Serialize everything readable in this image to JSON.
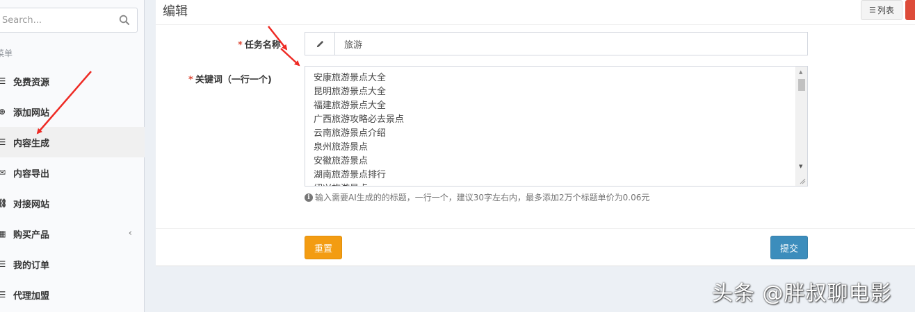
{
  "sidebar": {
    "search_placeholder": "Search...",
    "menu_header": "菜单",
    "items": [
      {
        "label": "免费资源",
        "icon": "list-icon"
      },
      {
        "label": "添加网站",
        "icon": "plus-circle-icon"
      },
      {
        "label": "内容生成",
        "icon": "list-icon"
      },
      {
        "label": "内容导出",
        "icon": "envelope-icon"
      },
      {
        "label": "对接网站",
        "icon": "share-nodes-icon"
      },
      {
        "label": "购买产品",
        "icon": "calendar-icon"
      },
      {
        "label": "我的订单",
        "icon": "list-icon"
      },
      {
        "label": "代理加盟",
        "icon": "list-icon"
      }
    ],
    "active_index": 2
  },
  "header": {
    "title": "编辑",
    "list_button": "列表"
  },
  "form": {
    "task_name_label": "任务名称",
    "task_name_value": "旅游",
    "keywords_label": "关键词（一行一个)",
    "keywords": [
      "安康旅游景点大全",
      "昆明旅游景点大全",
      "福建旅游景点大全",
      "广西旅游攻略必去景点",
      "云南旅游景点介绍",
      "泉州旅游景点",
      "安徽旅游景点",
      "湖南旅游景点排行",
      "绍兴旅游景点"
    ],
    "help_text": "输入需要AI生成的的标题，一行一个，建议30字左右内，最多添加2万个标题单价为0.06元",
    "reset_label": "重置",
    "submit_label": "提交"
  },
  "watermark": "头条 @胖叔聊电影",
  "colors": {
    "required": "#dd4b39",
    "reset": "#f39c12",
    "submit": "#3c8dbc",
    "danger": "#dd4b39",
    "annotation_arrow": "#ee2a24"
  }
}
